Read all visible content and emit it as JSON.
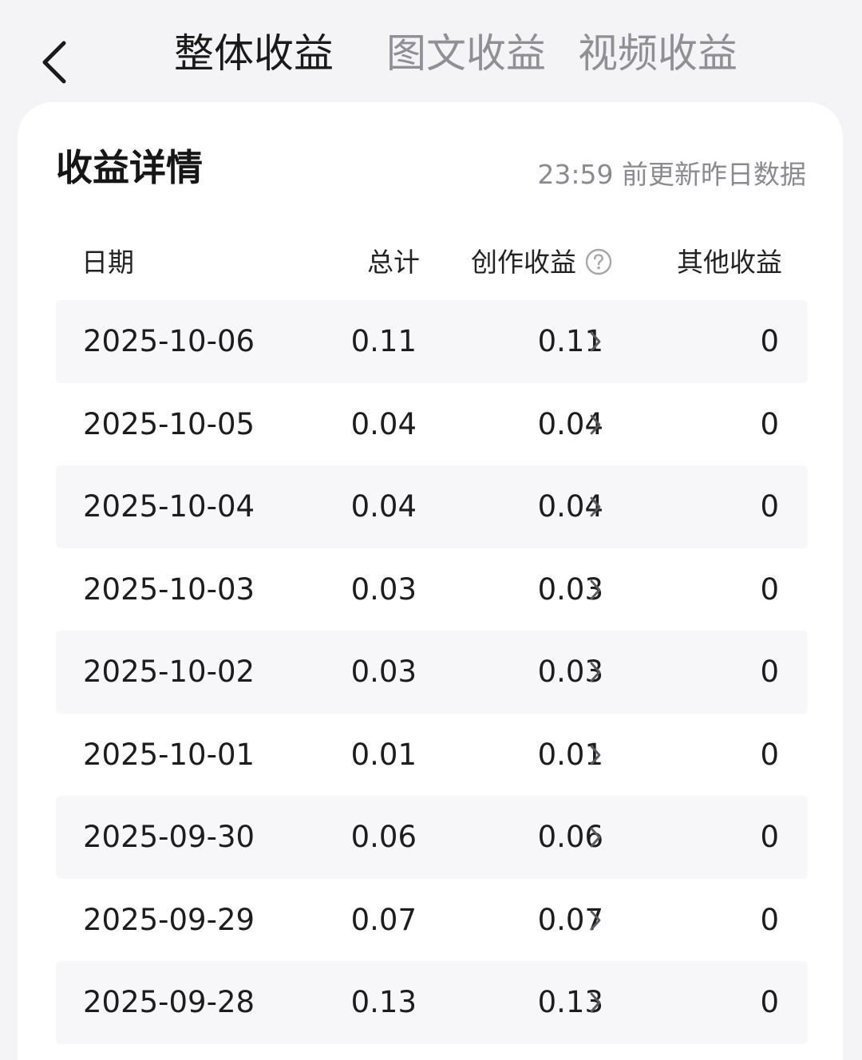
{
  "header": {
    "tabs": [
      {
        "label": "整体收益",
        "active": true
      },
      {
        "label": "图文收益",
        "active": false
      },
      {
        "label": "视频收益",
        "active": false
      }
    ]
  },
  "card": {
    "title": "收益详情",
    "update_note": "23:59 前更新昨日数据",
    "columns": {
      "date": "日期",
      "total": "总计",
      "creation": "创作收益",
      "other": "其他收益"
    },
    "rows": [
      {
        "date": "2025-10-06",
        "total": "0.11",
        "creation": "0.11",
        "other": "0"
      },
      {
        "date": "2025-10-05",
        "total": "0.04",
        "creation": "0.04",
        "other": "0"
      },
      {
        "date": "2025-10-04",
        "total": "0.04",
        "creation": "0.04",
        "other": "0"
      },
      {
        "date": "2025-10-03",
        "total": "0.03",
        "creation": "0.03",
        "other": "0"
      },
      {
        "date": "2025-10-02",
        "total": "0.03",
        "creation": "0.03",
        "other": "0"
      },
      {
        "date": "2025-10-01",
        "total": "0.01",
        "creation": "0.01",
        "other": "0"
      },
      {
        "date": "2025-09-30",
        "total": "0.06",
        "creation": "0.06",
        "other": "0"
      },
      {
        "date": "2025-09-29",
        "total": "0.07",
        "creation": "0.07",
        "other": "0"
      },
      {
        "date": "2025-09-28",
        "total": "0.13",
        "creation": "0.13",
        "other": "0"
      }
    ]
  },
  "icons": {
    "back": "chevron-left-icon",
    "help": "question-circle-icon",
    "row_arrow": "chevron-right-icon"
  },
  "colors": {
    "active_tab": "#1a1a1a",
    "inactive_tab": "#8f8f94",
    "page_bg": "#f4f4f6",
    "stripe_bg": "#f7f7f9"
  }
}
